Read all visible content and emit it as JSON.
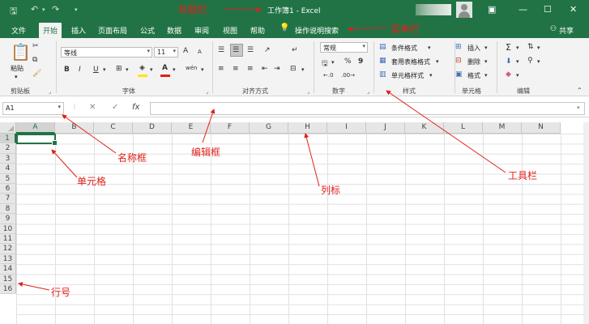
{
  "titlebar": {
    "save_icon": "save-icon",
    "undo_icon": "undo-icon",
    "redo_icon": "redo-icon",
    "doc_title": "工作簿1  -  Excel",
    "window_buttons": [
      "ribbon-display-icon",
      "minimize-icon",
      "maximize-icon",
      "close-icon"
    ]
  },
  "menubar": {
    "items": [
      "文件",
      "开始",
      "插入",
      "页面布局",
      "公式",
      "数据",
      "审阅",
      "视图",
      "帮助"
    ],
    "active": "开始",
    "search_label": "操作说明搜索",
    "share_label": "共享"
  },
  "ribbon": {
    "clipboard": {
      "paste_label": "粘贴",
      "group_label": "剪贴板"
    },
    "font": {
      "font_name": "等线",
      "font_size": "11",
      "bold": "B",
      "italic": "I",
      "underline": "U",
      "grow": "A",
      "shrink": "A",
      "font_color_letter": "A",
      "wen": "wén",
      "group_label": "字体"
    },
    "alignment": {
      "group_label": "对齐方式"
    },
    "number": {
      "format": "常规",
      "percent": "%",
      "comma": "9",
      "group_label": "数字"
    },
    "styles": {
      "conditional": "条件格式",
      "table_format": "套用表格格式",
      "cell_styles": "单元格样式",
      "group_label": "样式"
    },
    "cells": {
      "insert": "插入",
      "delete": "删除",
      "format": "格式",
      "group_label": "单元格"
    },
    "editing": {
      "group_label": "编辑"
    },
    "colors": {
      "font_color_bar": "#e31b1b",
      "fill_color_bar": "#ffe600"
    }
  },
  "formulabar": {
    "name_box": "A1",
    "cancel": "✕",
    "enter": "✓",
    "fx": "fx"
  },
  "grid": {
    "columns": [
      "A",
      "B",
      "C",
      "D",
      "E",
      "F",
      "G",
      "H",
      "I",
      "J",
      "K",
      "L",
      "M",
      "N"
    ],
    "rows": [
      "1",
      "2",
      "3",
      "4",
      "5",
      "6",
      "7",
      "8",
      "9",
      "10",
      "11",
      "12",
      "13",
      "14",
      "15",
      "16"
    ],
    "selected_column": "A",
    "selected_row": "1"
  },
  "annotations": {
    "title_bar": "标题栏",
    "menu_bar": "菜单栏",
    "name_box": "名称框",
    "formula_box": "编辑框",
    "cell": "单元格",
    "column_label": "列标",
    "toolbar": "工具栏",
    "row_number": "行号"
  },
  "theme": {
    "accent": "#217346",
    "annotation_color": "#e0201b"
  }
}
